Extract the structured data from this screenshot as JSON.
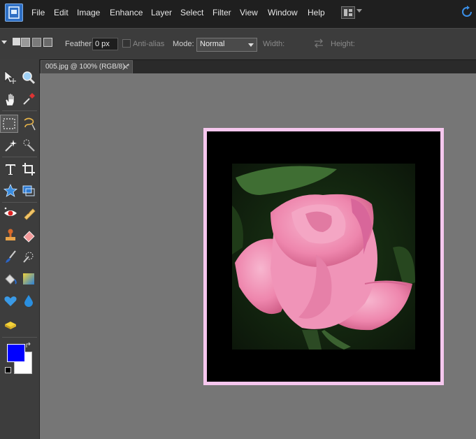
{
  "menubar": {
    "items": [
      "File",
      "Edit",
      "Image",
      "Enhance",
      "Layer",
      "Select",
      "Filter",
      "View",
      "Window",
      "Help"
    ],
    "app_icon": "photoshop-elements-icon",
    "layout_icon": "layout-grid-icon",
    "refresh_icon": "refresh-icon"
  },
  "options": {
    "feather_label": "Feather:",
    "feather_value": "0 px",
    "antialias_label": "Anti-alias",
    "mode_label": "Mode:",
    "mode_value": "Normal",
    "width_label": "Width:",
    "height_label": "Height:"
  },
  "document": {
    "tab_label": "005.jpg @ 100% (RGB/8) *",
    "close_glyph": "×"
  },
  "colors": {
    "foreground": "#0000ff",
    "background": "#ffffff",
    "frame": "#f6c7ee"
  },
  "tools": [
    "move-tool",
    "zoom-tool",
    "hand-tool",
    "eyedropper-tool",
    "rectangular-marquee-tool",
    "lasso-tool",
    "magic-wand-tool",
    "quick-selection-tool",
    "type-tool",
    "crop-tool",
    "custom-shape-tool",
    "recompose-tool",
    "red-eye-tool",
    "healing-brush-tool",
    "clone-stamp-tool",
    "eraser-tool",
    "brush-tool",
    "impressionist-brush-tool",
    "paint-bucket-tool",
    "gradient-tool",
    "smart-brush-tool",
    "blur-tool",
    "sponge-tool"
  ]
}
